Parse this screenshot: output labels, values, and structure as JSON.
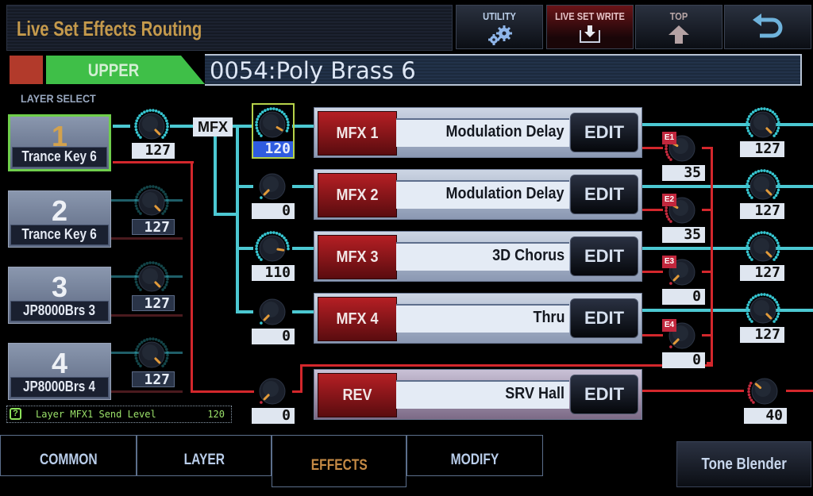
{
  "header": {
    "title": "Live Set Effects Routing",
    "buttons": [
      {
        "label": "UTILITY",
        "icon": "gear-icon"
      },
      {
        "label": "LIVE SET WRITE",
        "icon": "write-download-icon"
      },
      {
        "label": "TOP",
        "icon": "arrow-up-icon"
      },
      {
        "label": "",
        "icon": "back-arrow-icon"
      }
    ]
  },
  "part": {
    "label": "UPPER",
    "patch_name": "0054:Poly Brass 6",
    "accent_color": "#3fbf48"
  },
  "layer_select": {
    "heading": "LAYER SELECT",
    "layers": [
      {
        "num": "1",
        "name": "Trance Key 6",
        "level": "127",
        "selected": true
      },
      {
        "num": "2",
        "name": "Trance Key 6",
        "level": "127",
        "selected": false
      },
      {
        "num": "3",
        "name": "JP8000Brs 3",
        "level": "127",
        "selected": false
      },
      {
        "num": "4",
        "name": "JP8000Brs 4",
        "level": "127",
        "selected": false
      }
    ]
  },
  "mfx_label": "MFX",
  "mfx_sends": [
    "120",
    "0",
    "110",
    "0"
  ],
  "rev_send": "0",
  "effects": [
    {
      "tag": "MFX 1",
      "name": "Modulation Delay",
      "edit": "EDIT",
      "rev_tag": "E1",
      "rev_send": "35",
      "out_level": "127"
    },
    {
      "tag": "MFX 2",
      "name": "Modulation Delay",
      "edit": "EDIT",
      "rev_tag": "E2",
      "rev_send": "35",
      "out_level": "127"
    },
    {
      "tag": "MFX 3",
      "name": "3D Chorus",
      "edit": "EDIT",
      "rev_tag": "E3",
      "rev_send": "0",
      "out_level": "127"
    },
    {
      "tag": "MFX 4",
      "name": "Thru",
      "edit": "EDIT",
      "rev_tag": "E4",
      "rev_send": "0",
      "out_level": "127"
    }
  ],
  "reverb": {
    "tag": "REV",
    "name": "SRV Hall",
    "edit": "EDIT",
    "out_level": "40"
  },
  "help": {
    "icon": "?",
    "message": "Layer MFX1 Send Level",
    "value": "120"
  },
  "tabs": [
    {
      "label": "COMMON",
      "active": false
    },
    {
      "label": "LAYER",
      "active": false
    },
    {
      "label": "EFFECTS",
      "active": true
    },
    {
      "label": "MODIFY",
      "active": false
    }
  ],
  "tone_blender": "Tone Blender",
  "colors": {
    "cyan_route": "#4cc8d2",
    "red_route": "#d3272c",
    "title": "#c59a4c",
    "active_tab": "#c58a45"
  }
}
